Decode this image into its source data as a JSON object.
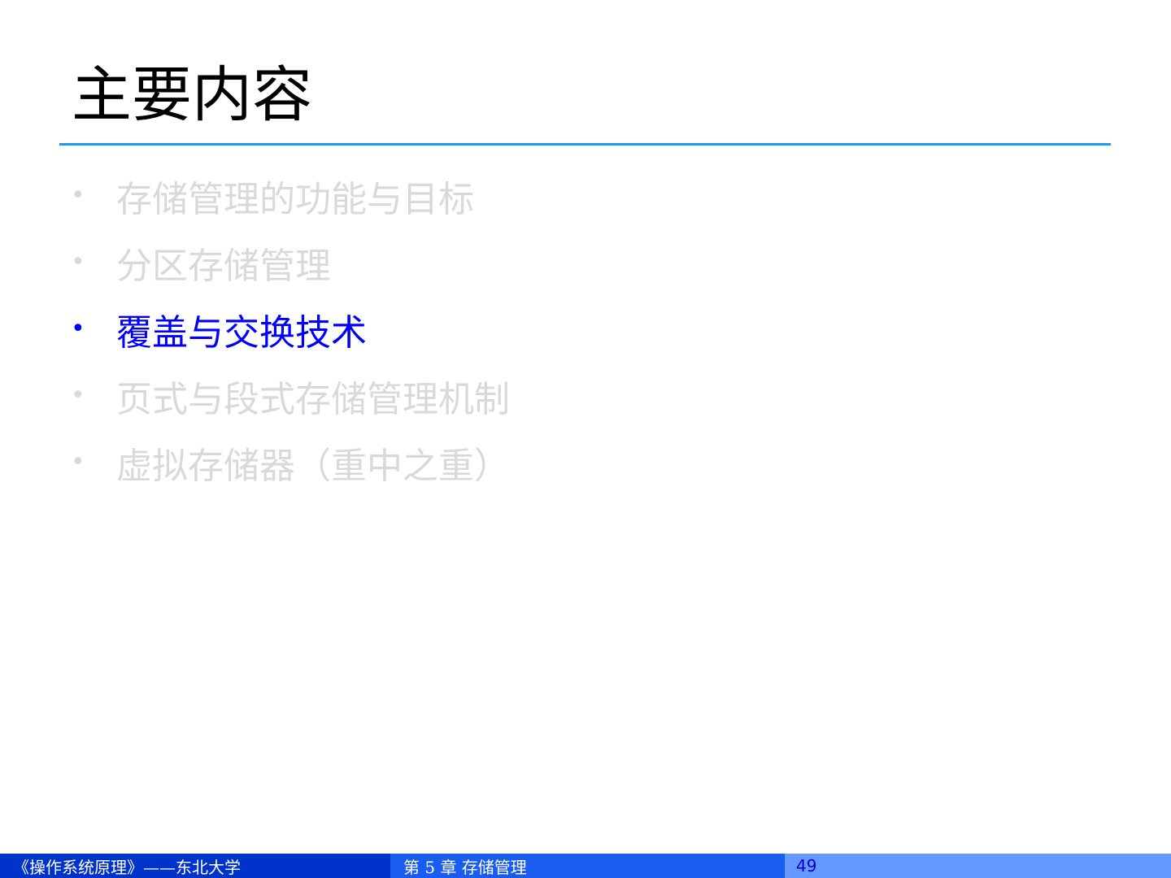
{
  "slide": {
    "title": "主要内容",
    "bullets": [
      {
        "marker": "•",
        "text": "存储管理的功能与目标",
        "state": "dimmed"
      },
      {
        "marker": "•",
        "text": "分区存储管理",
        "state": "dimmed"
      },
      {
        "marker": "•",
        "text": "覆盖与交换技术",
        "state": "active"
      },
      {
        "marker": "•",
        "text": "页式与段式存储管理机制",
        "state": "dimmed"
      },
      {
        "marker": "•",
        "text": "虚拟存储器（重中之重）",
        "state": "dimmed"
      }
    ]
  },
  "footer": {
    "course": "《操作系统原理》——东北大学",
    "chapter": "第 5 章  存储管理",
    "page_number": "49"
  },
  "colors": {
    "title_rule": "#1a9cf0",
    "active_bullet": "#0000ff",
    "dimmed_bullet": "#d9d9d9",
    "footer_left": "#0033cc",
    "footer_mid": "#1a5cf0",
    "footer_right": "#6699ff"
  }
}
